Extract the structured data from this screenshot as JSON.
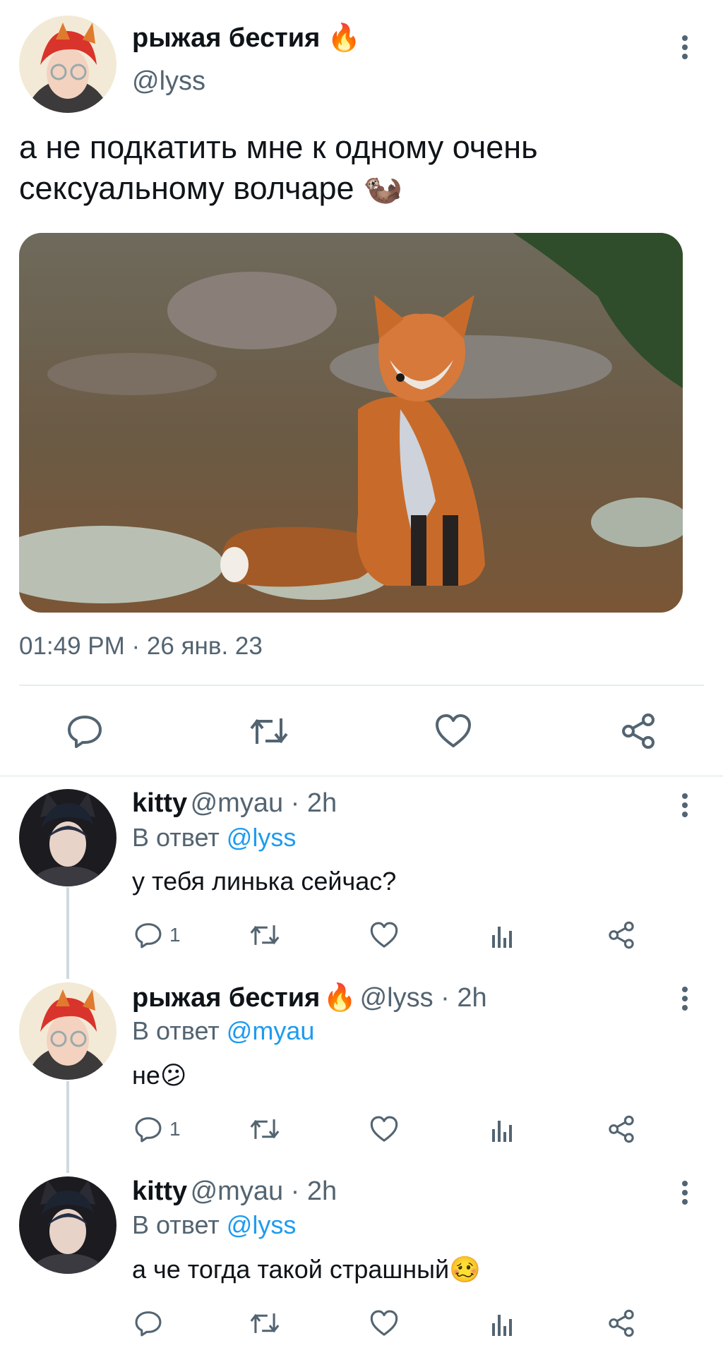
{
  "post": {
    "author_name": "рыжая бестия",
    "author_emoji": "🔥",
    "author_handle": "@lyss",
    "text_line1": "а не подкатить мне к одному очень",
    "text_line2": "сексуальному  волчаре",
    "text_emoji": "🦦",
    "timestamp": "01:49 PM · 26 янв. 23",
    "actions": [
      "reply-icon",
      "retweet-icon",
      "like-icon",
      "share-icon"
    ]
  },
  "replies": [
    {
      "name": "kitty",
      "emoji": "",
      "handle": "@myau · 2h",
      "reply_prefix": "В ответ ",
      "reply_to": "@lyss",
      "text": "у тебя линька сейчас?",
      "reply_count": "1"
    },
    {
      "name": "рыжая бестия",
      "emoji": "🔥",
      "handle": "@lyss · 2h",
      "reply_prefix": "В ответ ",
      "reply_to": "@myau",
      "text": "не😕",
      "reply_count": "1"
    },
    {
      "name": "kitty",
      "emoji": "",
      "handle": "@myau · 2h",
      "reply_prefix": "В ответ ",
      "reply_to": "@lyss",
      "text": "а че тогда такой страшный🥴",
      "reply_count": ""
    }
  ],
  "colors": {
    "accent": "#1d9bf0",
    "secondary_text": "#536471",
    "fire": "#f4511e"
  }
}
